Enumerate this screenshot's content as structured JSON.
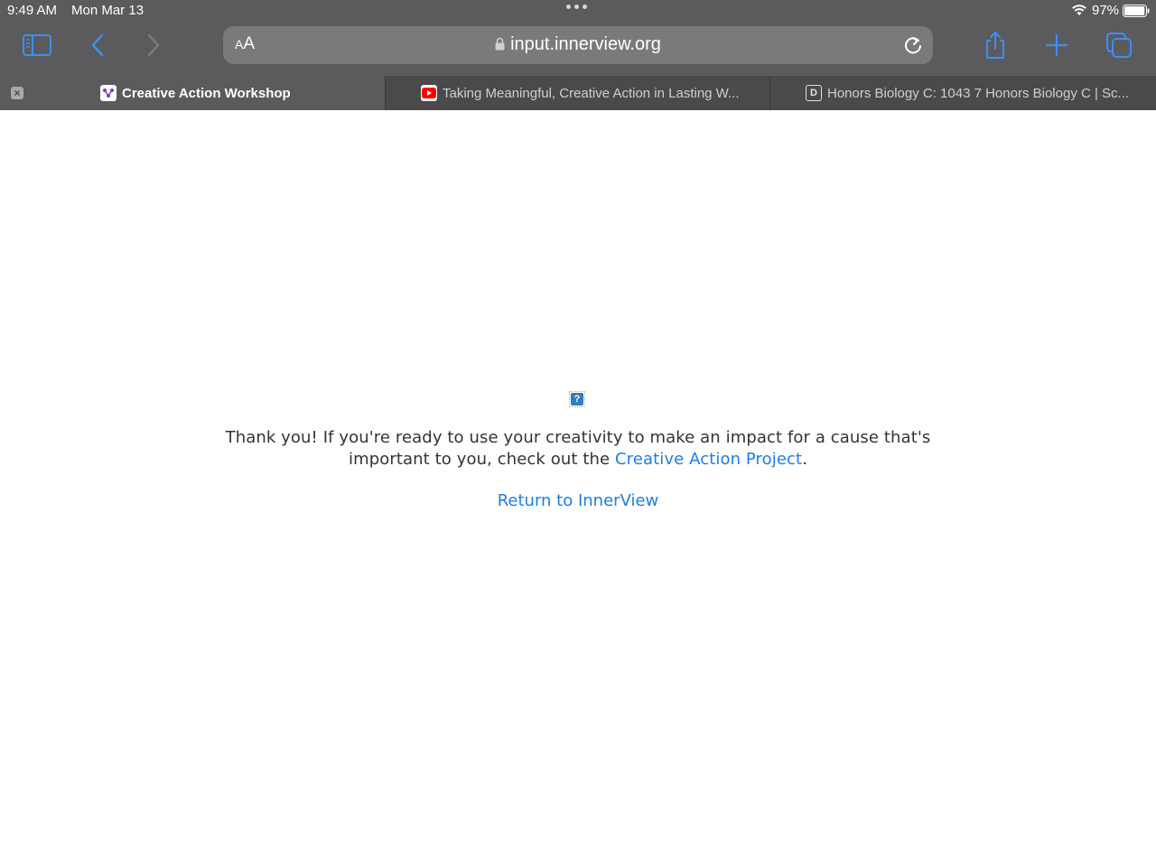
{
  "status": {
    "time": "9:49 AM",
    "date": "Mon Mar 13",
    "battery_percent": "97%",
    "battery_level": 0.97
  },
  "toolbar": {
    "aa_label_small": "A",
    "aa_label_large": "A",
    "url": "input.innerview.org"
  },
  "tabs": [
    {
      "title": "Creative Action Workshop",
      "active": true,
      "favicon": "innerview-logo-icon"
    },
    {
      "title": "Taking Meaningful, Creative Action in Lasting W...",
      "active": false,
      "favicon": "youtube-icon"
    },
    {
      "title": "Honors Biology C: 1043 7 Honors Biology C | Sc...",
      "active": false,
      "favicon": "d-letter-icon",
      "favicon_letter": "D"
    }
  ],
  "page": {
    "broken_image_glyph": "?",
    "message_prefix": "Thank you! If you're ready to use your creativity to make an impact for a cause that's important to you, check out the ",
    "message_link": "Creative Action Project",
    "message_suffix": ".",
    "return_link": "Return to InnerView"
  },
  "colors": {
    "link": "#1a7fe6",
    "toolbar_icon": "#3d8ef0",
    "chrome": "#5b5b5d"
  }
}
